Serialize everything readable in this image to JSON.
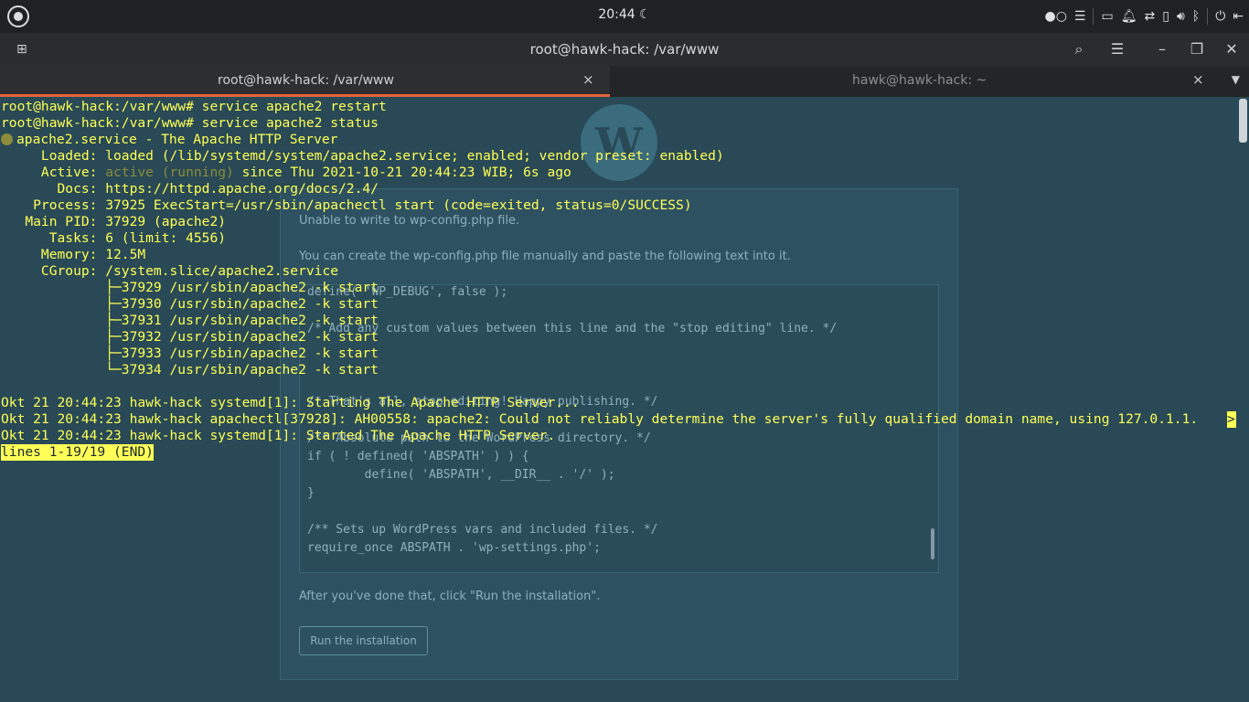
{
  "system_bar": {
    "clock": "20:44",
    "moon_icon": "crescent-moon-icon",
    "tray_icons": [
      "toggle-icon",
      "menu-icon",
      "folder-icon",
      "bell-icon",
      "network-icon",
      "battery-icon",
      "volume-icon",
      "bluetooth-icon",
      "power-icon",
      "logout-icon"
    ]
  },
  "window": {
    "title": "root@hawk-hack: /var/www"
  },
  "tabs": [
    {
      "label": "root@hawk-hack: /var/www",
      "close": "×"
    },
    {
      "label": "hawk@hawk-hack: ~",
      "close": "×"
    }
  ],
  "terminal": {
    "lines": [
      "root@hawk-hack:/var/www# service apache2 restart",
      "root@hawk-hack:/var/www# service apache2 status",
      "apache2.service - The Apache HTTP Server",
      "     Loaded: loaded (/lib/systemd/system/apache2.service; enabled; vendor preset: enabled)",
      "     Active: ",
      "       Docs: https://httpd.apache.org/docs/2.4/",
      "    Process: 37925 ExecStart=/usr/sbin/apachectl start (code=exited, status=0/SUCCESS)",
      "   Main PID: 37929 (apache2)",
      "      Tasks: 6 (limit: 4556)",
      "     Memory: 12.5M",
      "     CGroup: /system.slice/apache2.service",
      "             ├─37929 /usr/sbin/apache2 -k start",
      "             ├─37930 /usr/sbin/apache2 -k start",
      "             ├─37931 /usr/sbin/apache2 -k start",
      "             ├─37932 /usr/sbin/apache2 -k start",
      "             ├─37933 /usr/sbin/apache2 -k start",
      "             └─37934 /usr/sbin/apache2 -k start",
      "",
      "Okt 21 20:44:23 hawk-hack systemd[1]: Starting The Apache HTTP Server...",
      "Okt 21 20:44:23 hawk-hack apachectl[37928]: AH00558: apache2: Could not reliably determine the server's fully qualified domain name, using 127.0.1.1.",
      "Okt 21 20:44:23 hawk-hack systemd[1]: Started The Apache HTTP Server."
    ],
    "active_state": "active (running)",
    "active_since": " since Thu 2021-10-21 20:44:23 WIB; 6s ago",
    "overflow_marker": ">",
    "pager_status": "lines 1-19/19 (END)"
  },
  "background_page": {
    "error_text": "Unable to write to wp-config.php file.",
    "instruction": "You can create the wp-config.php file manually and paste the following text into it.",
    "code_lines": [
      "define( 'WP_DEBUG', false );",
      "",
      "/* Add any custom values between this line and the \"stop editing\" line. */",
      "",
      "",
      "",
      "/* That's all, stop editing! Happy publishing. */",
      "",
      "/** Absolute path to the WordPress directory. */",
      "if ( ! defined( 'ABSPATH' ) ) {",
      "        define( 'ABSPATH', __DIR__ . '/' );",
      "}",
      "",
      "/** Sets up WordPress vars and included files. */",
      "require_once ABSPATH . 'wp-settings.php';"
    ],
    "after_text": "After you've done that, click \"Run the installation\".",
    "run_button": "Run the installation"
  }
}
